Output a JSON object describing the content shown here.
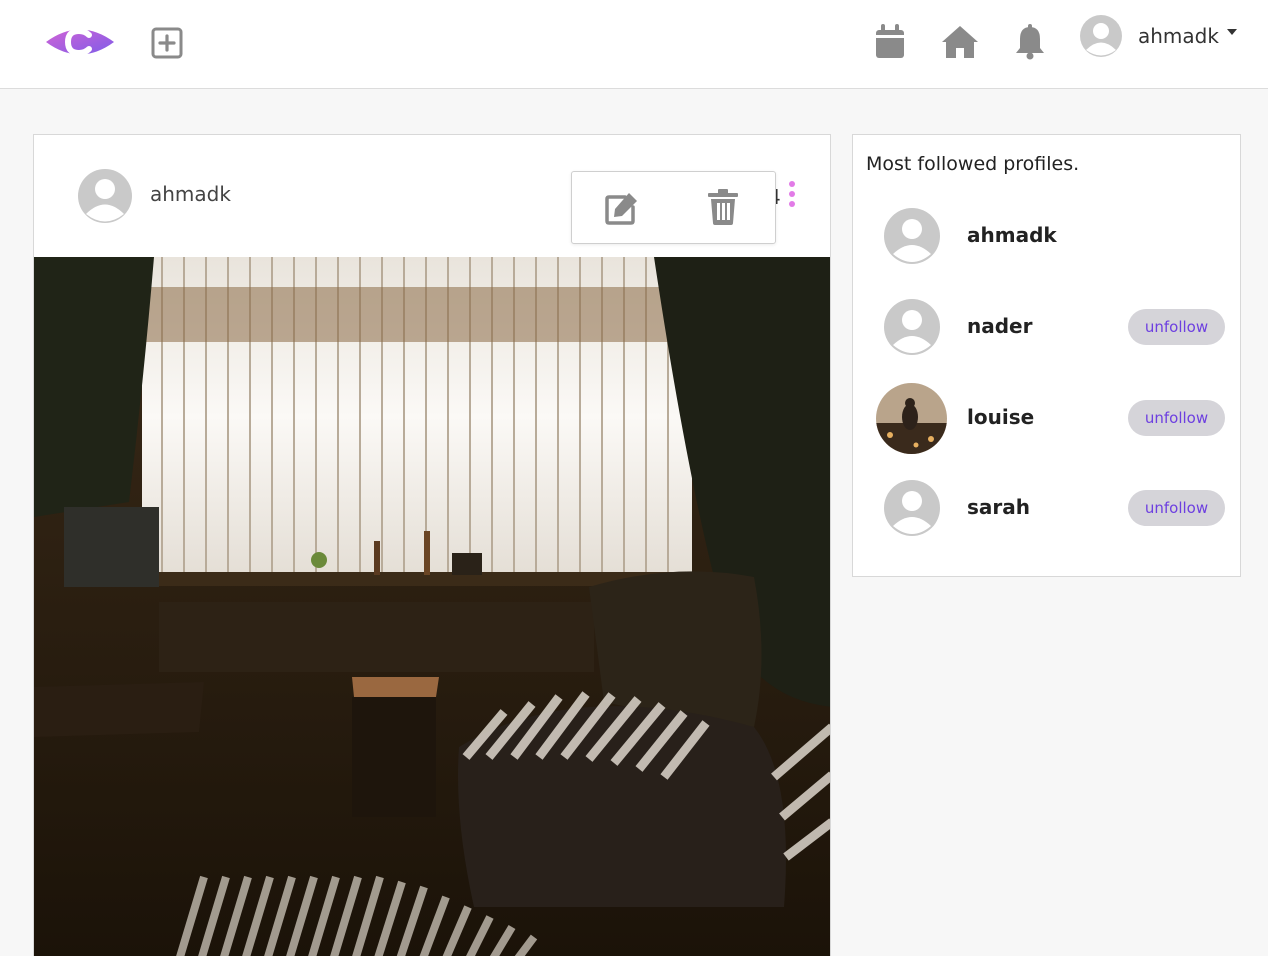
{
  "nav": {
    "username": "ahmadk",
    "icons": [
      "logo-eye-c",
      "add-post-icon",
      "calendar-icon",
      "home-icon",
      "bell-icon",
      "user-avatar",
      "caret-down-icon"
    ]
  },
  "post": {
    "author": "ahmadk",
    "count": "4",
    "menu": [
      "edit-icon",
      "trash-icon"
    ],
    "image_description": ""
  },
  "sidebar": {
    "title": "Most followed profiles.",
    "profiles": [
      {
        "name": "ahmadk",
        "button": ""
      },
      {
        "name": "nader",
        "button": "unfollow"
      },
      {
        "name": "louise",
        "button": "unfollow"
      },
      {
        "name": "sarah",
        "button": "unfollow"
      }
    ]
  },
  "colors": {
    "accent": "#e27be7",
    "button_text": "#6d3fe0",
    "button_bg": "#d5d4d9",
    "icon_gray": "#8a8a8a",
    "logo_gradient": [
      "#c45bd6",
      "#7b61e8"
    ]
  }
}
